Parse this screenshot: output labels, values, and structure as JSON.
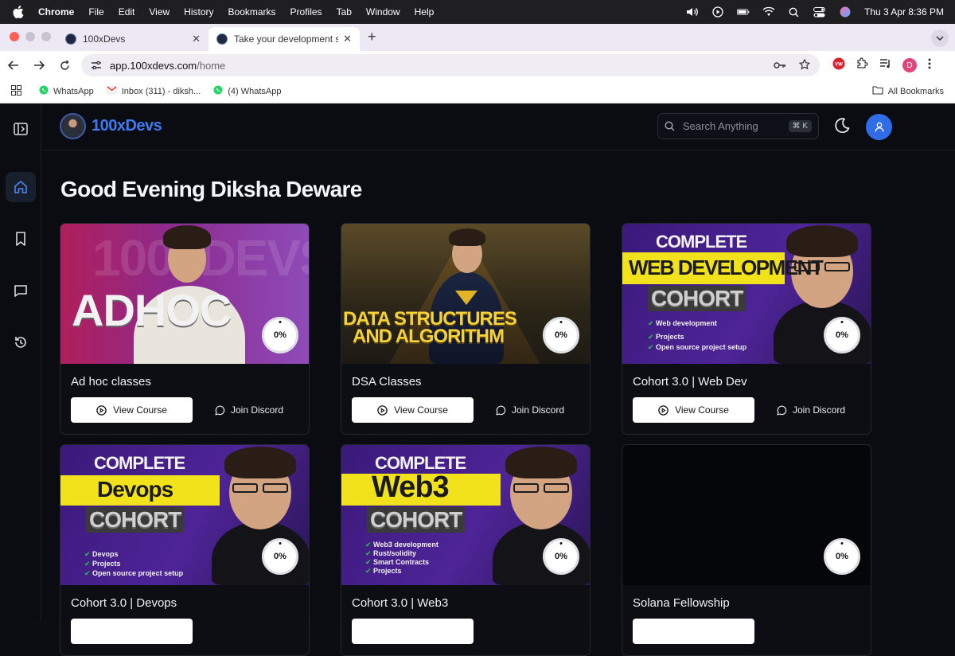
{
  "menubar": {
    "app": "Chrome",
    "items": [
      "File",
      "Edit",
      "View",
      "History",
      "Bookmarks",
      "Profiles",
      "Tab",
      "Window",
      "Help"
    ],
    "datetime": "Thu 3 Apr  8:36 PM"
  },
  "browser": {
    "tabs": [
      {
        "title": "100xDevs",
        "active": false
      },
      {
        "title": "Take your development skills",
        "active": true
      }
    ],
    "url_domain": "app.100xdevs.com",
    "url_path": "/home",
    "profile_initial": "D",
    "bookmarks": [
      "WhatsApp",
      "Inbox (311) - diksh...",
      "(4) WhatsApp"
    ],
    "all_bookmarks": "All Bookmarks"
  },
  "app": {
    "brand": "100xDevs",
    "search_placeholder": "Search Anything",
    "search_shortcut": "⌘ K",
    "greeting": "Good Evening Diksha Deware"
  },
  "courses": [
    {
      "title": "Ad hoc classes",
      "progress": "0%",
      "view_label": "View Course",
      "discord_label": "Join Discord",
      "thumb_text": "ADHOC"
    },
    {
      "title": "DSA Classes",
      "progress": "0%",
      "view_label": "View Course",
      "discord_label": "Join Discord",
      "thumb_text_1": "DATA STRUCTURES",
      "thumb_text_2": "AND ALGORITHM"
    },
    {
      "title": "Cohort 3.0 | Web Dev",
      "progress": "0%",
      "view_label": "View Course",
      "discord_label": "Join Discord",
      "thumb_top": "COMPLETE",
      "thumb_band": "WEB DEVELOPMENT",
      "thumb_bottom": "COHORT",
      "bullets": [
        "Web development",
        "Projects",
        "Open source project setup"
      ]
    },
    {
      "title": "Cohort 3.0 | Devops",
      "progress": "0%",
      "thumb_top": "COMPLETE",
      "thumb_band": "Devops",
      "thumb_bottom": "COHORT",
      "bullets": [
        "Devops",
        "Projects",
        "Open source project setup"
      ]
    },
    {
      "title": "Cohort 3.0 | Web3",
      "progress": "0%",
      "thumb_top": "COMPLETE",
      "thumb_band": "Web3",
      "thumb_bottom": "COHORT",
      "bullets": [
        "Web3 development",
        "Rust/solidity",
        "Smart Contracts",
        "Projects"
      ]
    },
    {
      "title": "Solana Fellowship",
      "progress": "0%"
    }
  ]
}
